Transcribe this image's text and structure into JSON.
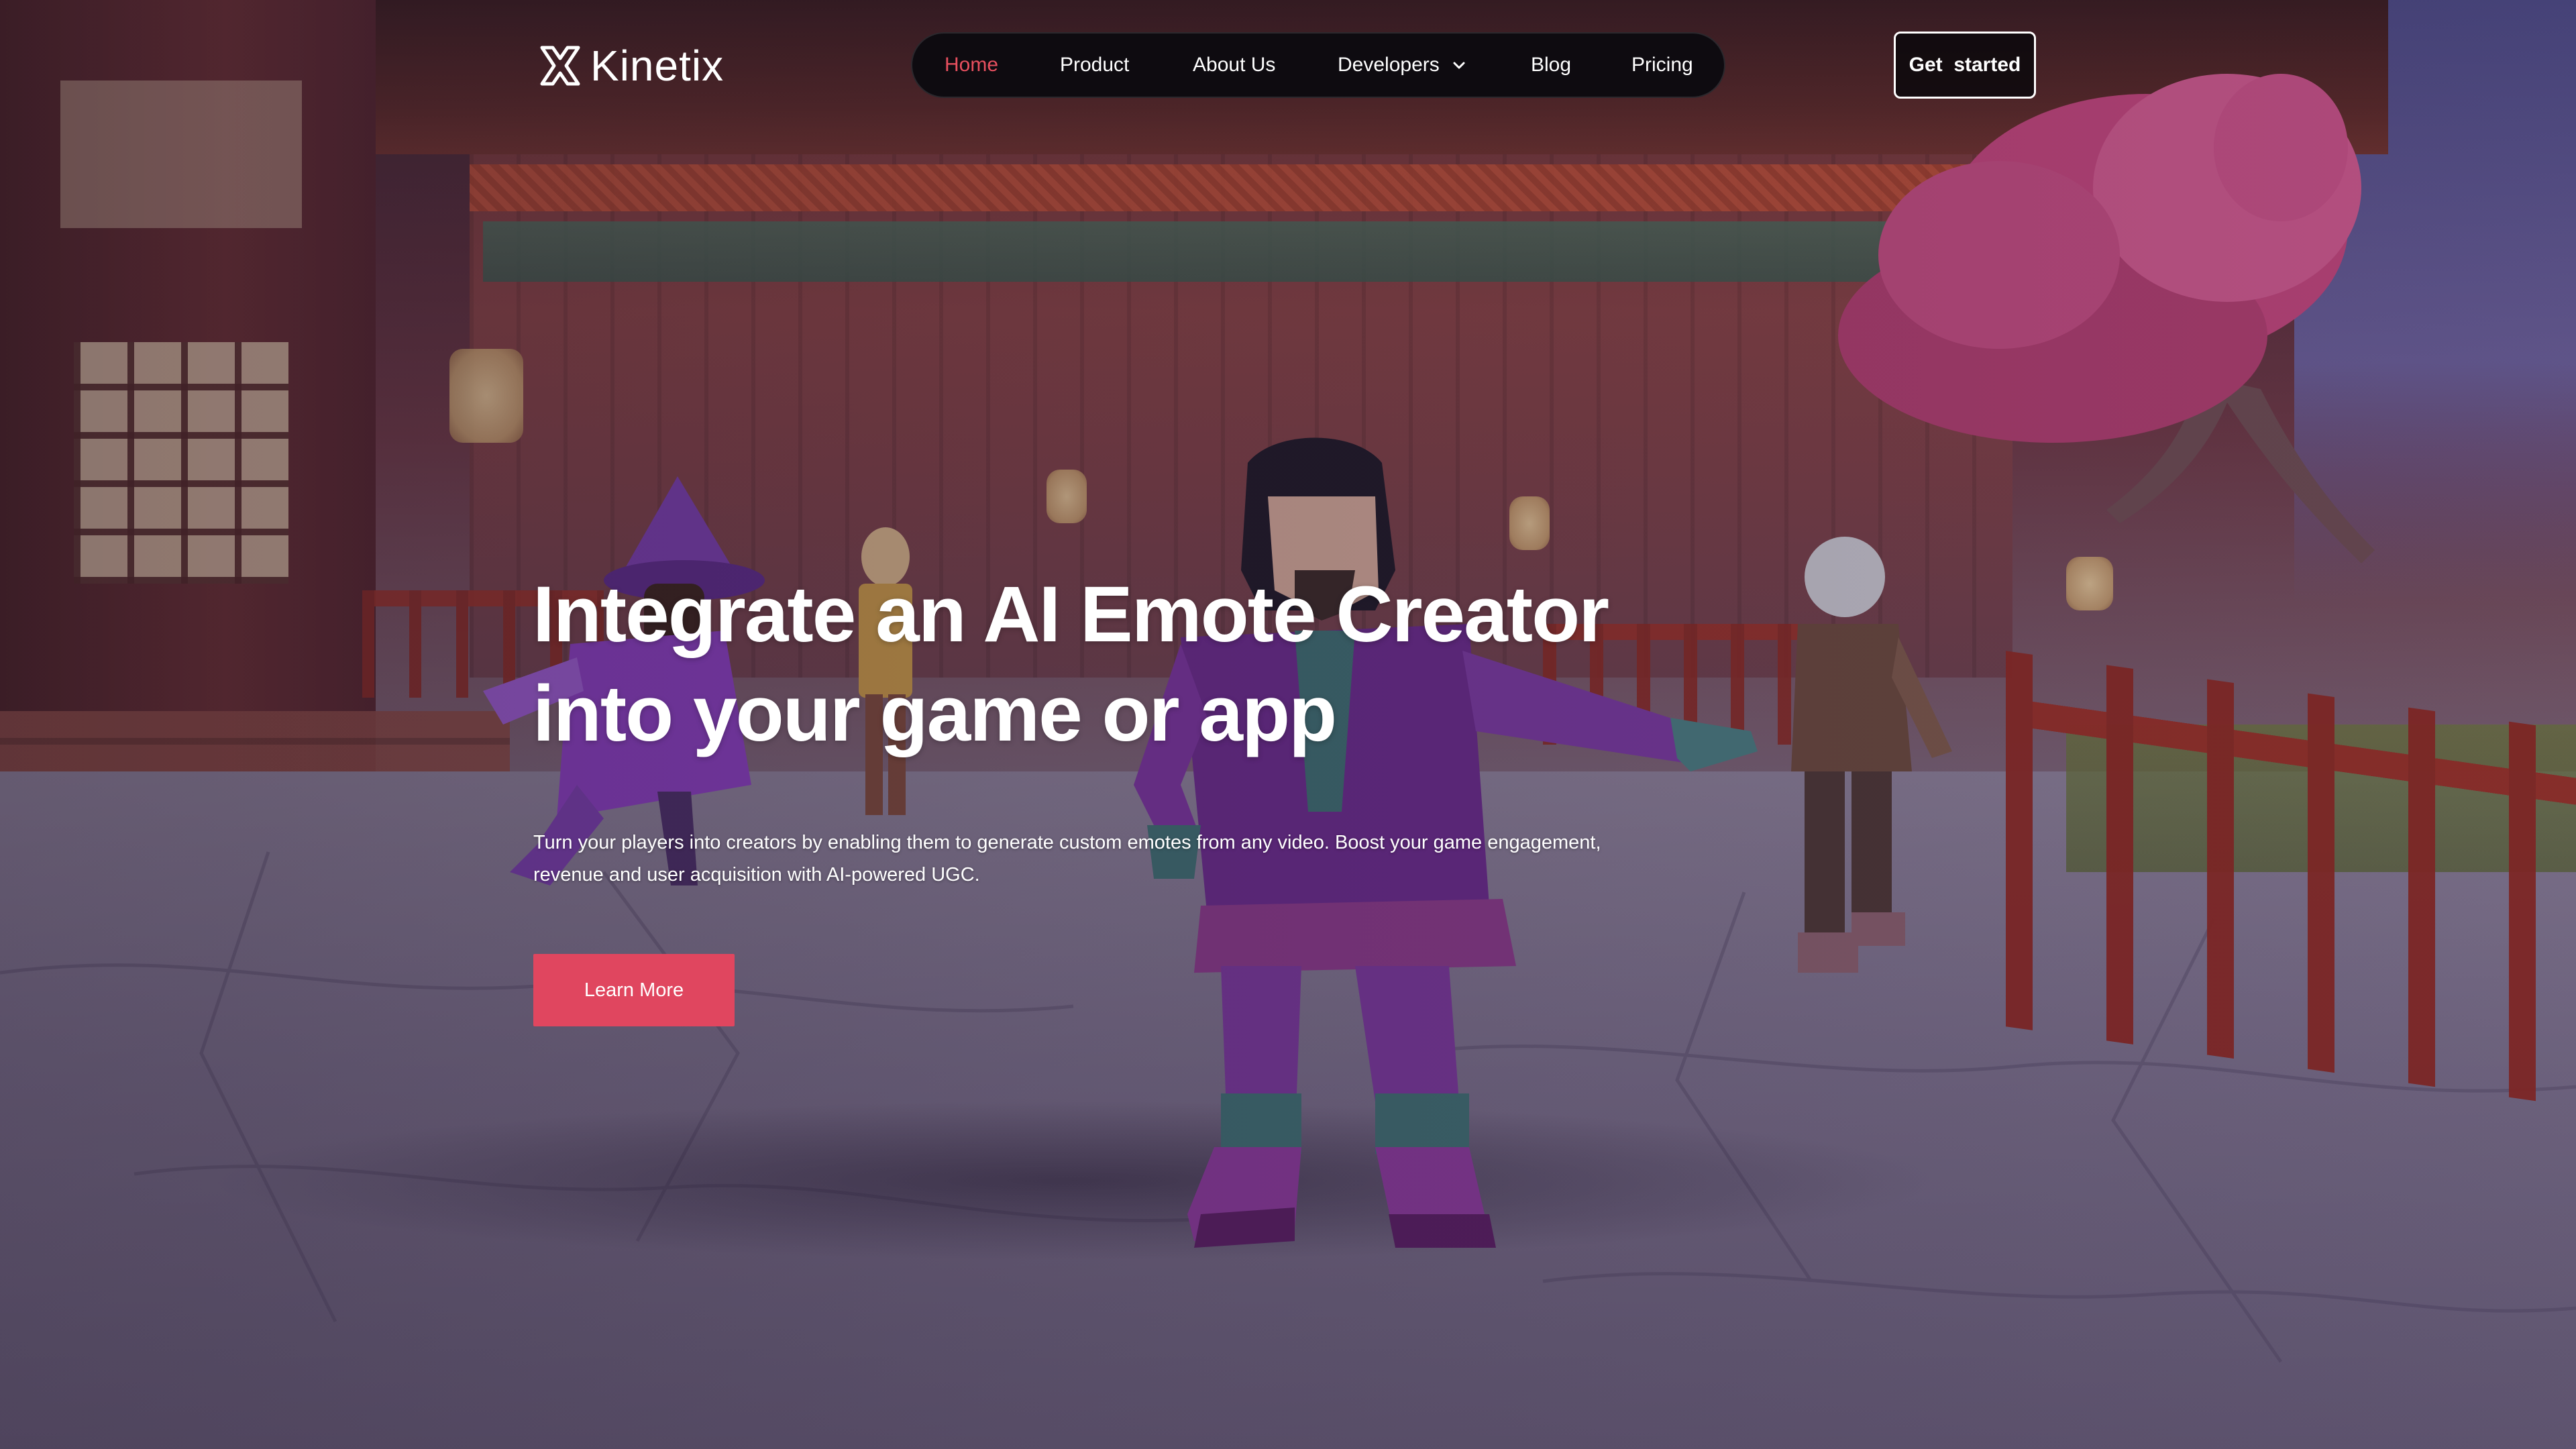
{
  "brand": {
    "name": "Kinetix",
    "logo_icon": "kinetix-x-logo-icon"
  },
  "nav": {
    "items": [
      {
        "label": "Home",
        "active": true
      },
      {
        "label": "Product"
      },
      {
        "label": "About Us"
      },
      {
        "label": "Developers",
        "icon": "chevron-down-icon"
      },
      {
        "label": "Blog"
      },
      {
        "label": "Pricing"
      }
    ]
  },
  "header": {
    "cta_label": "Get  started"
  },
  "hero": {
    "title_line1": "Integrate an AI Emote Creator",
    "title_line2": "into your game or app",
    "subtitle_line1": "Turn your players into creators by enabling them to generate custom emotes from any video. Boost your game engagement,",
    "subtitle_line2": "revenue and user acquisition with AI-powered UGC.",
    "button_label": "Learn More"
  },
  "colors": {
    "accent": "#e0465f",
    "nav_active": "#e8505f",
    "nav_background": "#0e0b10",
    "text": "#ffffff"
  }
}
